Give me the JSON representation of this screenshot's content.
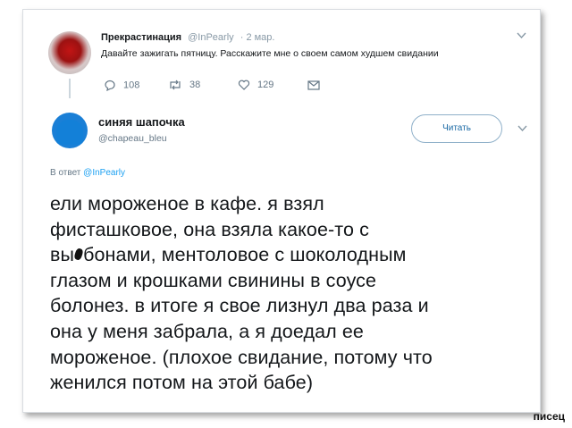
{
  "tweet1": {
    "author_name": "Прекрастинация",
    "handle": "@InPearly",
    "date": "· 2 мар.",
    "text": "Давайте зажигать пятницу. Расскажите мне о своем самом худшем свидании",
    "replies": "108",
    "retweets": "38",
    "likes": "129"
  },
  "tweet2": {
    "author_name": "синяя шапочка",
    "handle": "@chapeau_bleu",
    "follow_label": "Читать",
    "reply_prefix": "В ответ",
    "reply_to": "@InPearly",
    "lines": [
      "ели мороженое в кафе. я взял",
      "фисташковое, она взяла какое-то с",
      "бонами, ментоловое с шоколодным",
      "глазом и крошками свинины в соусе",
      "болонез. в итоге я свое лизнул два раза и",
      "она у меня забрала, а я доедал ее",
      "мороженое.  (плохое свидание, потому что",
      "женился потом на этой бабе)"
    ],
    "line3_prefix": "вы"
  },
  "watermark": "писец",
  "colors": {
    "link": "#1da1f2",
    "muted": "#657786",
    "text": "#14171a"
  }
}
